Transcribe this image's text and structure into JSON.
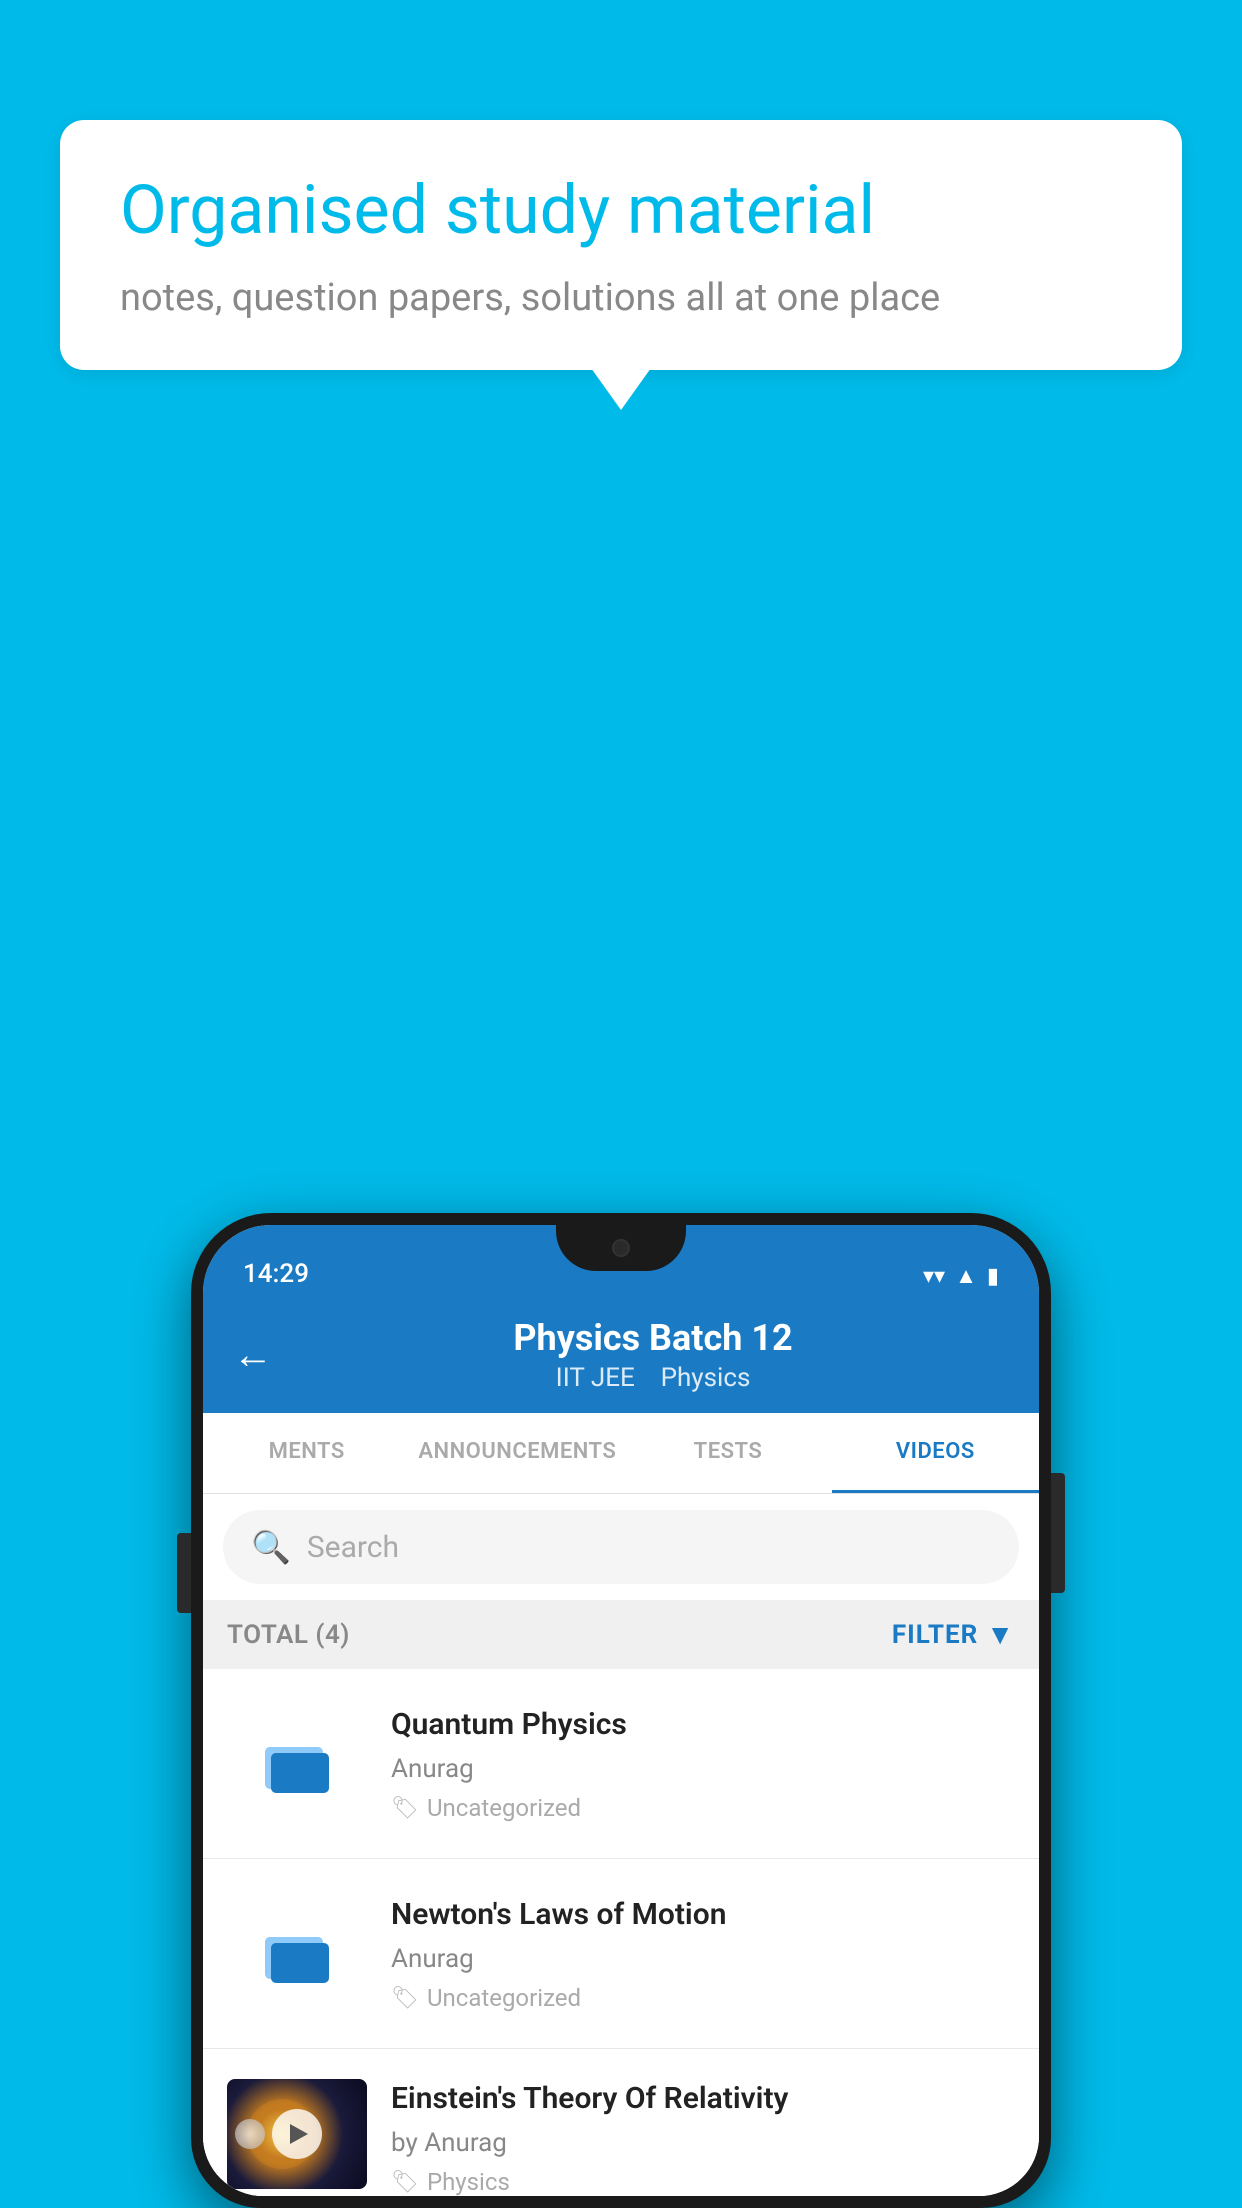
{
  "background_color": "#00BBEA",
  "speech_bubble": {
    "headline": "Organised study material",
    "subtext": "notes, question papers, solutions all at one place"
  },
  "phone": {
    "status_bar": {
      "time": "14:29",
      "icons": [
        "wifi",
        "signal",
        "battery"
      ]
    },
    "header": {
      "back_label": "←",
      "title": "Physics Batch 12",
      "subtitle_parts": [
        "IIT JEE",
        "Physics"
      ]
    },
    "tabs": [
      {
        "label": "MENTS",
        "active": false
      },
      {
        "label": "ANNOUNCEMENTS",
        "active": false
      },
      {
        "label": "TESTS",
        "active": false
      },
      {
        "label": "VIDEOS",
        "active": true
      }
    ],
    "search": {
      "placeholder": "Search"
    },
    "filter_bar": {
      "total_label": "TOTAL (4)",
      "filter_label": "FILTER"
    },
    "video_items": [
      {
        "title": "Quantum Physics",
        "author": "Anurag",
        "tag": "Uncategorized",
        "has_thumbnail": false
      },
      {
        "title": "Newton's Laws of Motion",
        "author": "Anurag",
        "tag": "Uncategorized",
        "has_thumbnail": false
      },
      {
        "title": "Einstein's Theory Of Relativity",
        "author": "by Anurag",
        "tag": "Physics",
        "has_thumbnail": true
      }
    ]
  }
}
